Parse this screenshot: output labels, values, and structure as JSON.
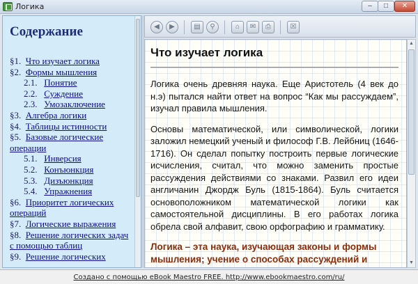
{
  "window": {
    "title": "Логика",
    "icon": "book-icon",
    "controls": [
      "minimize",
      "maximize",
      "close"
    ]
  },
  "toc": {
    "title": "Содержание",
    "items": [
      {
        "num": "§1.",
        "label": "Что изучает логика",
        "level": 0
      },
      {
        "num": "§2.",
        "label": "Формы мышления",
        "level": 0
      },
      {
        "num": "2.1.",
        "label": "Понятие",
        "level": 1
      },
      {
        "num": "2.2.",
        "label": "Суждение",
        "level": 1
      },
      {
        "num": "2.3.",
        "label": "Умозаключение",
        "level": 1
      },
      {
        "num": "§3.",
        "label": "Алгебра логики",
        "level": 0
      },
      {
        "num": "§4.",
        "label": "Таблицы истинности",
        "level": 0
      },
      {
        "num": "§5.",
        "label": "Базовые логические операции",
        "level": 0
      },
      {
        "num": "5.1.",
        "label": "Инверсия",
        "level": 1
      },
      {
        "num": "5.2.",
        "label": "Конъюнкция",
        "level": 1
      },
      {
        "num": "5.3.",
        "label": "Дизъюнкция",
        "level": 1
      },
      {
        "num": "5.4.",
        "label": "Упражнения",
        "level": 1
      },
      {
        "num": "§6.",
        "label": "Приоритет логических операций",
        "level": 0
      },
      {
        "num": "§7.",
        "label": "Логические выражения",
        "level": 0
      },
      {
        "num": "§8.",
        "label": "Решение логических задач с помощью таблиц",
        "level": 0
      },
      {
        "num": "§9.",
        "label": "Решение логических",
        "level": 0
      }
    ]
  },
  "toolbar": {
    "buttons": [
      "back-icon",
      "forward-icon",
      "contents-icon",
      "search-icon",
      "home-icon",
      "email-icon",
      "print-icon",
      "close-book-icon"
    ]
  },
  "content": {
    "heading": "Что изучает логика",
    "paragraphs": [
      "Логика очень древняя наука. Еще Аристотель (4 век до н.э) пытался найти ответ на вопрос “Как мы рассуждаем”, изучал правила мышления.",
      "Основы математической, или символической, логики заложил немецкий ученый и философ Г.В. Лейбниц (1646-1716). Он сделал попытку построить первые логические исчисления, считал, что можно заменить простые рассуждения действиями со знаками. Развил его идеи англичанин Джордж Буль (1815-1864). Буль считается основоположником математической логики как самостоятельной дисциплины. В его работах логика обрела свой алфавит, свою орфографию и грамматику."
    ],
    "highlight": "Логика – эта наука, изучающая законы и формы мышления; учение о способах рассуждений и"
  },
  "footer": {
    "text": "Создано с помощью eBook Maestro FREE. http://www.ebookmaestro.com/ru/"
  },
  "colors": {
    "toc_bg": "#d4ecfa",
    "toc_title": "#1d2d7a",
    "highlight": "#8a2c0a"
  }
}
